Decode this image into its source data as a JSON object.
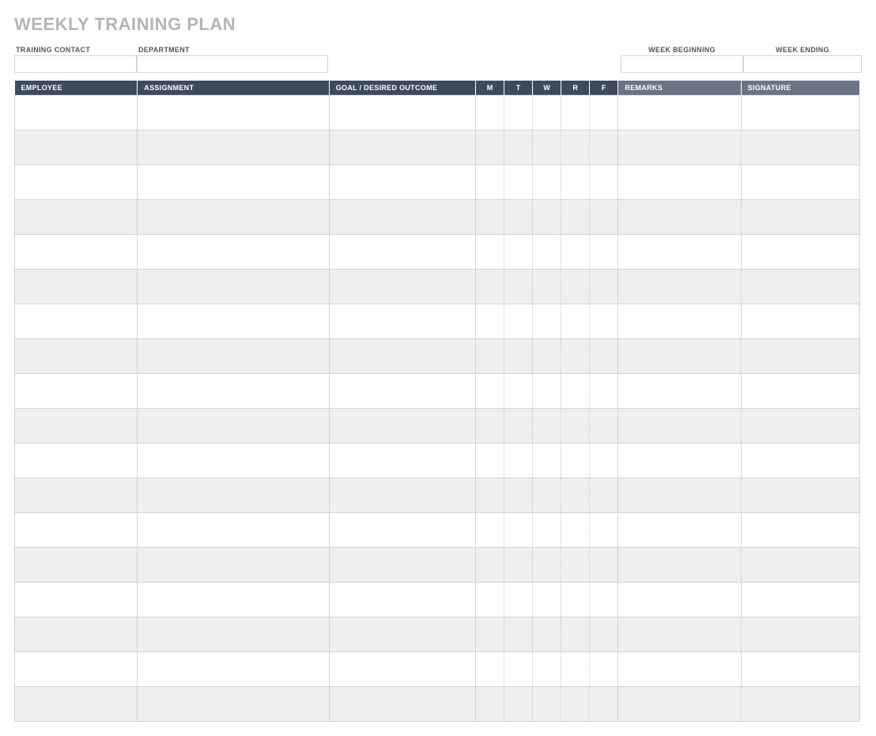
{
  "title": "WEEKLY TRAINING PLAN",
  "fields": {
    "training_contact_label": "TRAINING CONTACT",
    "training_contact_value": "",
    "department_label": "DEPARTMENT",
    "department_value": "",
    "week_beginning_label": "WEEK BEGINNING",
    "week_beginning_value": "",
    "week_ending_label": "WEEK ENDING",
    "week_ending_value": ""
  },
  "columns": {
    "employee": "EMPLOYEE",
    "assignment": "ASSIGNMENT",
    "goal": "GOAL / DESIRED OUTCOME",
    "m": "M",
    "t": "T",
    "w": "W",
    "r": "R",
    "f": "F",
    "remarks": "REMARKS",
    "signature": "SIGNATURE"
  },
  "rows": [
    {
      "employee": "",
      "assignment": "",
      "goal": "",
      "m": "",
      "t": "",
      "w": "",
      "r": "",
      "f": "",
      "remarks": "",
      "signature": ""
    },
    {
      "employee": "",
      "assignment": "",
      "goal": "",
      "m": "",
      "t": "",
      "w": "",
      "r": "",
      "f": "",
      "remarks": "",
      "signature": ""
    },
    {
      "employee": "",
      "assignment": "",
      "goal": "",
      "m": "",
      "t": "",
      "w": "",
      "r": "",
      "f": "",
      "remarks": "",
      "signature": ""
    },
    {
      "employee": "",
      "assignment": "",
      "goal": "",
      "m": "",
      "t": "",
      "w": "",
      "r": "",
      "f": "",
      "remarks": "",
      "signature": ""
    },
    {
      "employee": "",
      "assignment": "",
      "goal": "",
      "m": "",
      "t": "",
      "w": "",
      "r": "",
      "f": "",
      "remarks": "",
      "signature": ""
    },
    {
      "employee": "",
      "assignment": "",
      "goal": "",
      "m": "",
      "t": "",
      "w": "",
      "r": "",
      "f": "",
      "remarks": "",
      "signature": ""
    },
    {
      "employee": "",
      "assignment": "",
      "goal": "",
      "m": "",
      "t": "",
      "w": "",
      "r": "",
      "f": "",
      "remarks": "",
      "signature": ""
    },
    {
      "employee": "",
      "assignment": "",
      "goal": "",
      "m": "",
      "t": "",
      "w": "",
      "r": "",
      "f": "",
      "remarks": "",
      "signature": ""
    },
    {
      "employee": "",
      "assignment": "",
      "goal": "",
      "m": "",
      "t": "",
      "w": "",
      "r": "",
      "f": "",
      "remarks": "",
      "signature": ""
    },
    {
      "employee": "",
      "assignment": "",
      "goal": "",
      "m": "",
      "t": "",
      "w": "",
      "r": "",
      "f": "",
      "remarks": "",
      "signature": ""
    },
    {
      "employee": "",
      "assignment": "",
      "goal": "",
      "m": "",
      "t": "",
      "w": "",
      "r": "",
      "f": "",
      "remarks": "",
      "signature": ""
    },
    {
      "employee": "",
      "assignment": "",
      "goal": "",
      "m": "",
      "t": "",
      "w": "",
      "r": "",
      "f": "",
      "remarks": "",
      "signature": ""
    },
    {
      "employee": "",
      "assignment": "",
      "goal": "",
      "m": "",
      "t": "",
      "w": "",
      "r": "",
      "f": "",
      "remarks": "",
      "signature": ""
    },
    {
      "employee": "",
      "assignment": "",
      "goal": "",
      "m": "",
      "t": "",
      "w": "",
      "r": "",
      "f": "",
      "remarks": "",
      "signature": ""
    },
    {
      "employee": "",
      "assignment": "",
      "goal": "",
      "m": "",
      "t": "",
      "w": "",
      "r": "",
      "f": "",
      "remarks": "",
      "signature": ""
    },
    {
      "employee": "",
      "assignment": "",
      "goal": "",
      "m": "",
      "t": "",
      "w": "",
      "r": "",
      "f": "",
      "remarks": "",
      "signature": ""
    },
    {
      "employee": "",
      "assignment": "",
      "goal": "",
      "m": "",
      "t": "",
      "w": "",
      "r": "",
      "f": "",
      "remarks": "",
      "signature": ""
    },
    {
      "employee": "",
      "assignment": "",
      "goal": "",
      "m": "",
      "t": "",
      "w": "",
      "r": "",
      "f": "",
      "remarks": "",
      "signature": ""
    }
  ]
}
